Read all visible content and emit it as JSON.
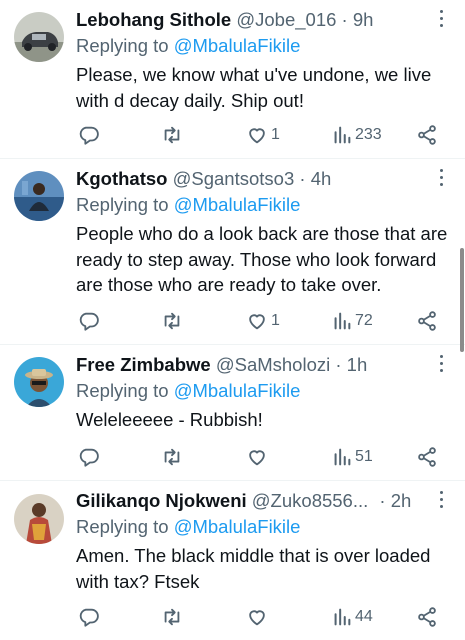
{
  "replies": [
    {
      "name": "Lebohang Sithole",
      "handle": "@Jobe_016",
      "time": "· 9h",
      "replying_prefix": "Replying to",
      "replying_to": "@MbalulaFikile",
      "text": "Please, we know what u've undone, we live with d decay daily. Ship out!",
      "likes": "1",
      "views": "233"
    },
    {
      "name": "Kgothatso",
      "handle": "@Sgantsotso3",
      "time": "· 4h",
      "replying_prefix": "Replying to",
      "replying_to": "@MbalulaFikile",
      "text": "People who do a look back are those that are ready to step away. Those who look forward are those who are ready to take over.",
      "likes": "1",
      "views": "72"
    },
    {
      "name": "Free Zimbabwe",
      "handle": "@SaMsholozi",
      "time": "· 1h",
      "replying_prefix": "Replying to",
      "replying_to": "@MbalulaFikile",
      "text": "Weleleeeee  - Rubbish!",
      "likes": "",
      "views": "51"
    },
    {
      "name": "Gilikanqo Njokweni",
      "handle": "@Zuko8556...",
      "time": "· 2h",
      "replying_prefix": "Replying to",
      "replying_to": "@MbalulaFikile",
      "text": "Amen. The black middle that is over loaded with tax? Ftsek",
      "likes": "",
      "views": "44"
    }
  ],
  "colors": {
    "text": "#0f1419",
    "secondary": "#536471",
    "link": "#1d9bf0",
    "divider": "#eff3f4"
  },
  "icons": [
    "reply-icon",
    "retweet-icon",
    "like-icon",
    "views-icon",
    "share-icon",
    "more-icon"
  ]
}
